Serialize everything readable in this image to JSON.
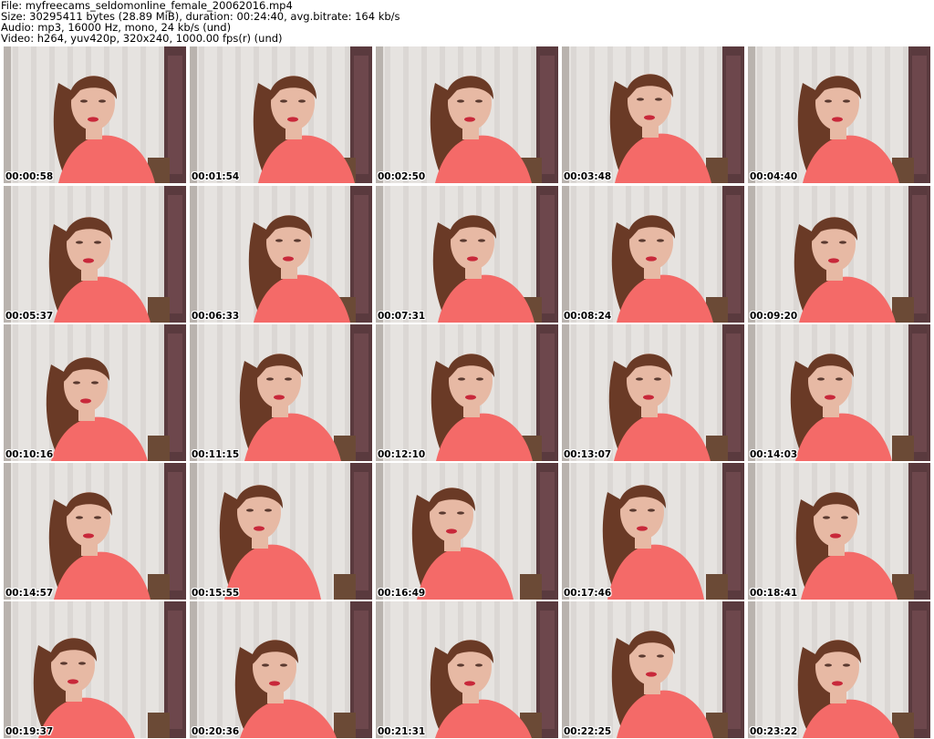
{
  "header": {
    "file_line": "File: myfreecams_seldomonline_female_20062016.mp4",
    "size_line": "Size: 30295411 bytes (28.89 MiB), duration: 00:24:40, avg.bitrate: 164 kb/s",
    "audio_line": "Audio: mp3, 16000 Hz, mono, 24 kb/s (und)",
    "video_line": "Video: h264, yuv420p, 320x240, 1000.00 fps(r) (und)"
  },
  "thumbnails": [
    {
      "timestamp": "00:00:58"
    },
    {
      "timestamp": "00:01:54"
    },
    {
      "timestamp": "00:02:50"
    },
    {
      "timestamp": "00:03:48"
    },
    {
      "timestamp": "00:04:40"
    },
    {
      "timestamp": "00:05:37"
    },
    {
      "timestamp": "00:06:33"
    },
    {
      "timestamp": "00:07:31"
    },
    {
      "timestamp": "00:08:24"
    },
    {
      "timestamp": "00:09:20"
    },
    {
      "timestamp": "00:10:16"
    },
    {
      "timestamp": "00:11:15"
    },
    {
      "timestamp": "00:12:10"
    },
    {
      "timestamp": "00:13:07"
    },
    {
      "timestamp": "00:14:03"
    },
    {
      "timestamp": "00:14:57"
    },
    {
      "timestamp": "00:15:55"
    },
    {
      "timestamp": "00:16:49"
    },
    {
      "timestamp": "00:17:46"
    },
    {
      "timestamp": "00:18:41"
    },
    {
      "timestamp": "00:19:37"
    },
    {
      "timestamp": "00:20:36"
    },
    {
      "timestamp": "00:21:31"
    },
    {
      "timestamp": "00:22:25"
    },
    {
      "timestamp": "00:23:22"
    }
  ],
  "colors": {
    "background": "#ffffff",
    "curtain": "#e6e3e0",
    "wall_dark": "#5a3a3e",
    "shirt": "#f46a68",
    "hair": "#6a3a26",
    "skin": "#e7b9a4",
    "lips": "#c8283a"
  }
}
